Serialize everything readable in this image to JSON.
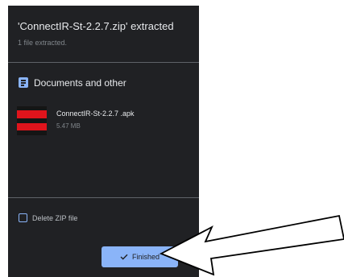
{
  "dialog": {
    "title": "'ConnectIR-St-2.2.7.zip' extracted",
    "subtitle": "1 file extracted."
  },
  "section": {
    "title": "Documents and other",
    "icon": "document-icon"
  },
  "file": {
    "name": "ConnectIR-St-2.2.7 .apk",
    "size": "5.47 MB"
  },
  "options": {
    "delete_zip_label": "Delete ZIP file",
    "delete_zip_checked": false
  },
  "actions": {
    "finished_label": "Finished",
    "finished_icon": "check-icon"
  },
  "colors": {
    "dialog_background": "#202124",
    "accent": "#8ab4f8",
    "annotation_arrow": "#ffffff"
  }
}
